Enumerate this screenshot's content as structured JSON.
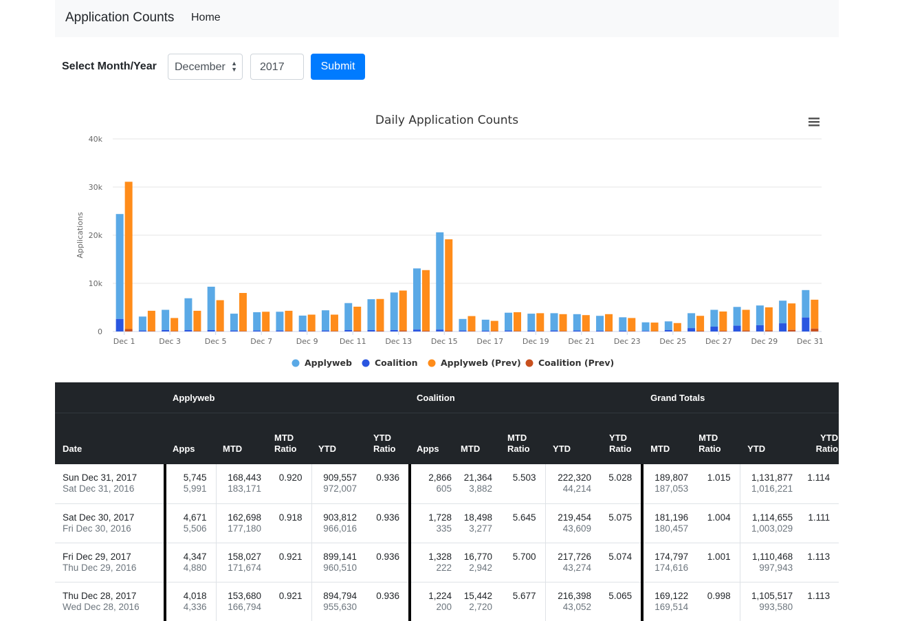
{
  "nav": {
    "brand": "Application Counts",
    "home": "Home"
  },
  "form": {
    "label": "Select Month/Year",
    "month": "December",
    "year": "2017",
    "submit": "Submit"
  },
  "chart_data": {
    "type": "bar",
    "title": "Daily Application Counts",
    "ylabel": "Applications",
    "ylim": [
      0,
      40000
    ],
    "yticks": [
      "0",
      "10k",
      "20k",
      "30k",
      "40k"
    ],
    "categories": [
      "Dec 1",
      "Dec 2",
      "Dec 3",
      "Dec 4",
      "Dec 5",
      "Dec 6",
      "Dec 7",
      "Dec 8",
      "Dec 9",
      "Dec 10",
      "Dec 11",
      "Dec 12",
      "Dec 13",
      "Dec 14",
      "Dec 15",
      "Dec 16",
      "Dec 17",
      "Dec 18",
      "Dec 19",
      "Dec 20",
      "Dec 21",
      "Dec 22",
      "Dec 23",
      "Dec 24",
      "Dec 25",
      "Dec 26",
      "Dec 27",
      "Dec 28",
      "Dec 29",
      "Dec 30",
      "Dec 31"
    ],
    "xtick_labels": [
      "Dec 1",
      "Dec 3",
      "Dec 5",
      "Dec 7",
      "Dec 9",
      "Dec 11",
      "Dec 13",
      "Dec 15",
      "Dec 17",
      "Dec 19",
      "Dec 21",
      "Dec 23",
      "Dec 25",
      "Dec 27",
      "Dec 29",
      "Dec 31"
    ],
    "stacking": "applyweb stacked on coalition",
    "series": [
      {
        "name": "Applyweb",
        "color": "#5aa9e6",
        "values": [
          21800,
          2900,
          4200,
          6600,
          9000,
          3500,
          3800,
          3900,
          3100,
          4200,
          5600,
          6400,
          7800,
          12700,
          20200,
          2400,
          2300,
          3700,
          3500,
          3600,
          3400,
          3100,
          2800,
          1800,
          1800,
          3100,
          3500,
          3900,
          4100,
          4700,
          5700
        ]
      },
      {
        "name": "Coalition",
        "color": "#2a56e0",
        "values": [
          2600,
          200,
          300,
          300,
          300,
          200,
          200,
          200,
          200,
          200,
          300,
          300,
          300,
          400,
          400,
          200,
          150,
          200,
          200,
          200,
          200,
          150,
          150,
          100,
          300,
          700,
          1000,
          1200,
          1300,
          1700,
          2900
        ]
      },
      {
        "name": "Applyweb (Prev)",
        "color": "#ff8c1a",
        "values": [
          30600,
          4200,
          2700,
          4200,
          6400,
          7900,
          4000,
          4200,
          3400,
          3400,
          5000,
          6600,
          8300,
          12600,
          19000,
          3100,
          2100,
          3900,
          3700,
          3500,
          3300,
          3500,
          2700,
          1800,
          1700,
          3100,
          4000,
          4300,
          4800,
          5500,
          6000
        ]
      },
      {
        "name": "Coalition (Prev)",
        "color": "#c8501e",
        "values": [
          500,
          100,
          100,
          100,
          100,
          100,
          100,
          100,
          100,
          100,
          150,
          150,
          200,
          150,
          150,
          100,
          100,
          100,
          100,
          100,
          100,
          100,
          100,
          50,
          50,
          150,
          150,
          200,
          220,
          330,
          600
        ]
      }
    ],
    "legend_position": "bottom-center",
    "grid": true
  },
  "table": {
    "groups": [
      "Applyweb",
      "Coalition",
      "Grand Totals"
    ],
    "columns": [
      "Date",
      "Apps",
      "MTD",
      "MTD\nRatio",
      "YTD",
      "YTD\nRatio",
      "Apps",
      "MTD",
      "MTD\nRatio",
      "YTD",
      "YTD\nRatio",
      "MTD",
      "MTD\nRatio",
      "YTD",
      "YTD\nRatio"
    ],
    "col_labels": {
      "date": "Date",
      "apps": "Apps",
      "mtd": "MTD",
      "mtd_ratio_1": "MTD",
      "mtd_ratio_2": "Ratio",
      "ytd": "YTD",
      "ytd_ratio_1": "YTD",
      "ytd_ratio_2": "Ratio"
    },
    "rows": [
      {
        "date": "Sun Dec 31, 2017",
        "date_prev": "Sat Dec 31, 2016",
        "aw_apps": "5,745",
        "aw_apps_prev": "5,991",
        "aw_mtd": "168,443",
        "aw_mtd_prev": "183,171",
        "aw_mtd_ratio": "0.920",
        "aw_ytd": "909,557",
        "aw_ytd_prev": "972,007",
        "aw_ytd_ratio": "0.936",
        "co_apps": "2,866",
        "co_apps_prev": "605",
        "co_mtd": "21,364",
        "co_mtd_prev": "3,882",
        "co_mtd_ratio": "5.503",
        "co_ytd": "222,320",
        "co_ytd_prev": "44,214",
        "co_ytd_ratio": "5.028",
        "gt_mtd": "189,807",
        "gt_mtd_prev": "187,053",
        "gt_mtd_ratio": "1.015",
        "gt_ytd": "1,131,877",
        "gt_ytd_prev": "1,016,221",
        "gt_ytd_ratio": "1.114"
      },
      {
        "date": "Sat Dec 30, 2017",
        "date_prev": "Fri Dec 30, 2016",
        "aw_apps": "4,671",
        "aw_apps_prev": "5,506",
        "aw_mtd": "162,698",
        "aw_mtd_prev": "177,180",
        "aw_mtd_ratio": "0.918",
        "aw_ytd": "903,812",
        "aw_ytd_prev": "966,016",
        "aw_ytd_ratio": "0.936",
        "co_apps": "1,728",
        "co_apps_prev": "335",
        "co_mtd": "18,498",
        "co_mtd_prev": "3,277",
        "co_mtd_ratio": "5.645",
        "co_ytd": "219,454",
        "co_ytd_prev": "43,609",
        "co_ytd_ratio": "5.075",
        "gt_mtd": "181,196",
        "gt_mtd_prev": "180,457",
        "gt_mtd_ratio": "1.004",
        "gt_ytd": "1,114,655",
        "gt_ytd_prev": "1,003,029",
        "gt_ytd_ratio": "1.111"
      },
      {
        "date": "Fri Dec 29, 2017",
        "date_prev": "Thu Dec 29, 2016",
        "aw_apps": "4,347",
        "aw_apps_prev": "4,880",
        "aw_mtd": "158,027",
        "aw_mtd_prev": "171,674",
        "aw_mtd_ratio": "0.921",
        "aw_ytd": "899,141",
        "aw_ytd_prev": "960,510",
        "aw_ytd_ratio": "0.936",
        "co_apps": "1,328",
        "co_apps_prev": "222",
        "co_mtd": "16,770",
        "co_mtd_prev": "2,942",
        "co_mtd_ratio": "5.700",
        "co_ytd": "217,726",
        "co_ytd_prev": "43,274",
        "co_ytd_ratio": "5.074",
        "gt_mtd": "174,797",
        "gt_mtd_prev": "174,616",
        "gt_mtd_ratio": "1.001",
        "gt_ytd": "1,110,468",
        "gt_ytd_prev": "997,943",
        "gt_ytd_ratio": "1.113"
      },
      {
        "date": "Thu Dec 28, 2017",
        "date_prev": "Wed Dec 28, 2016",
        "aw_apps": "4,018",
        "aw_apps_prev": "4,336",
        "aw_mtd": "153,680",
        "aw_mtd_prev": "166,794",
        "aw_mtd_ratio": "0.921",
        "aw_ytd": "894,794",
        "aw_ytd_prev": "955,630",
        "aw_ytd_ratio": "0.936",
        "co_apps": "1,224",
        "co_apps_prev": "200",
        "co_mtd": "15,442",
        "co_mtd_prev": "2,720",
        "co_mtd_ratio": "5.677",
        "co_ytd": "216,398",
        "co_ytd_prev": "43,052",
        "co_ytd_ratio": "5.065",
        "gt_mtd": "169,122",
        "gt_mtd_prev": "169,514",
        "gt_mtd_ratio": "0.998",
        "gt_ytd": "1,105,517",
        "gt_ytd_prev": "993,580",
        "gt_ytd_ratio": "1.113"
      }
    ]
  }
}
